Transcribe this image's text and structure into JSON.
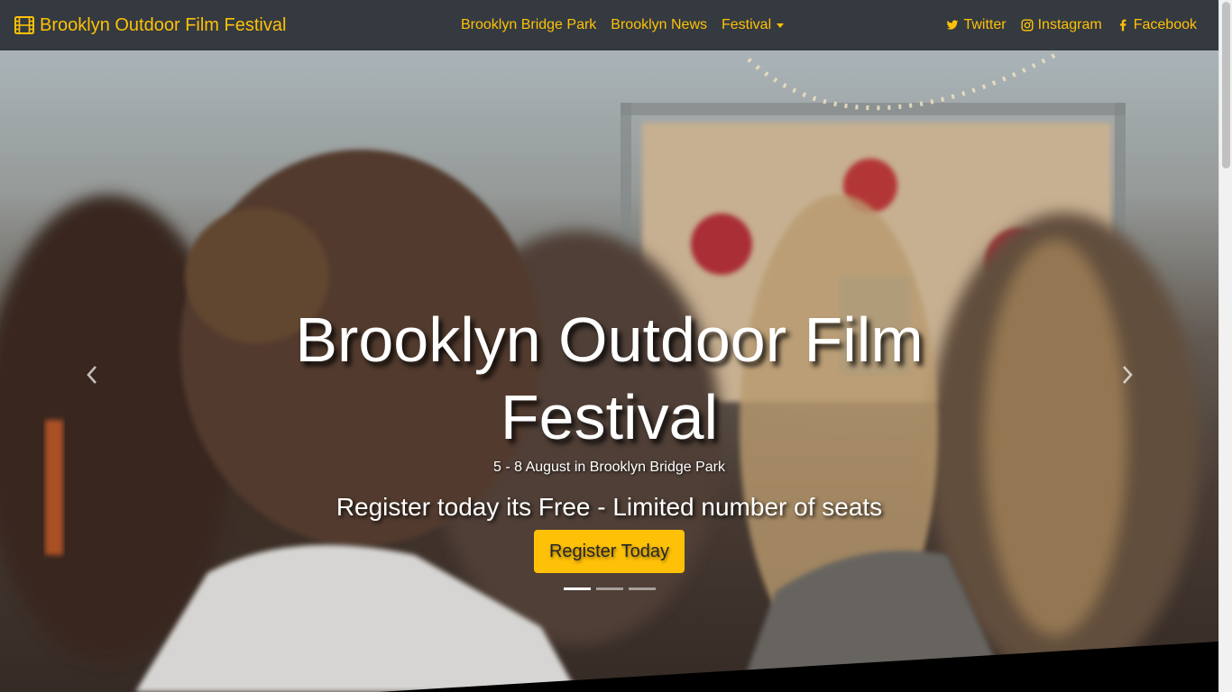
{
  "navbar": {
    "brand": "Brooklyn Outdoor Film Festival",
    "links": [
      {
        "label": "Brooklyn Bridge Park"
      },
      {
        "label": "Brooklyn News"
      },
      {
        "label": "Festival"
      }
    ],
    "social": [
      {
        "label": "Twitter",
        "icon": "twitter-icon"
      },
      {
        "label": "Instagram",
        "icon": "instagram-icon"
      },
      {
        "label": "Facebook",
        "icon": "facebook-icon"
      }
    ]
  },
  "hero": {
    "title": "Brooklyn Outdoor Film Festival",
    "date": "5 - 8 August in Brooklyn Bridge Park",
    "tagline": "Register today its Free - Limited number of seats",
    "button": "Register Today",
    "slides": 3,
    "active_slide": 1
  },
  "colors": {
    "navbar_bg": "#343a40",
    "accent": "#ffc107",
    "text_dark": "#212529"
  }
}
